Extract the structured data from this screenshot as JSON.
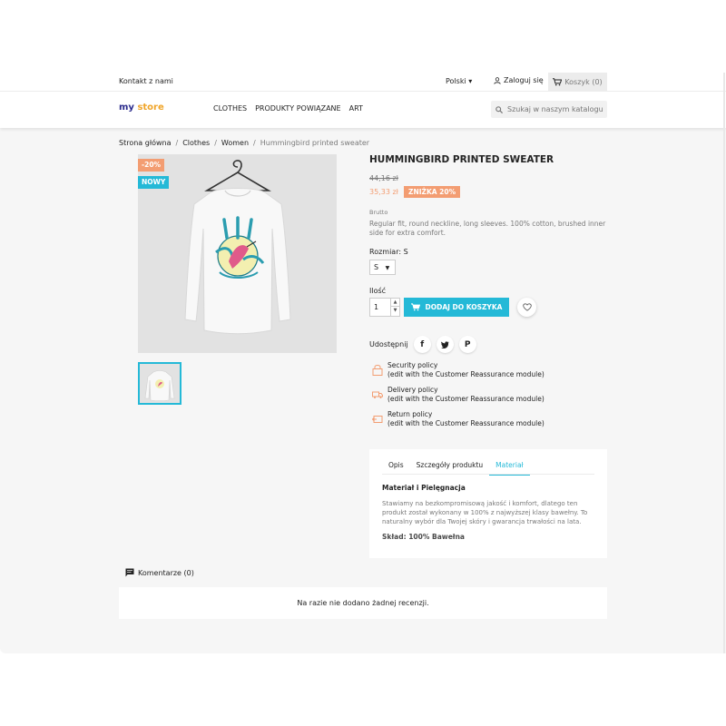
{
  "topbar": {
    "contact": "Kontakt z nami",
    "language": "Polski",
    "login": "Zaloguj się",
    "cart": "Koszyk (0)"
  },
  "header": {
    "logo_part1": "my",
    "logo_part2": "store",
    "nav": [
      "CLOTHES",
      "PRODUKTY POWIĄZANE",
      "ART"
    ],
    "search_placeholder": "Szukaj w naszym katalogu"
  },
  "breadcrumb": [
    "Strona główna",
    "Clothes",
    "Women",
    "Hummingbird printed sweater"
  ],
  "product": {
    "flag_discount": "-20%",
    "flag_new": "NOWY",
    "name": "HUMMINGBIRD PRINTED SWEATER",
    "old_price": "44,16 zł",
    "price": "35,33 zł",
    "discount_badge": "ZNIŻKA 20%",
    "tax_label": "Brutto",
    "description": "Regular fit, round neckline, long sleeves. 100% cotton, brushed inner side for extra comfort.",
    "size_label": "Rozmiar: S",
    "size_value": "S",
    "qty_label": "Ilość",
    "qty_value": "1",
    "add_to_cart": "DODAJ DO KOSZYKA",
    "share_label": "Udostępnij"
  },
  "reassurance": [
    {
      "title": "Security policy",
      "sub": "(edit with the Customer Reassurance module)"
    },
    {
      "title": "Delivery policy",
      "sub": "(edit with the Customer Reassurance module)"
    },
    {
      "title": "Return policy",
      "sub": "(edit with the Customer Reassurance module)"
    }
  ],
  "tabs": {
    "items": [
      "Opis",
      "Szczegóły produktu",
      "Materiał"
    ],
    "active_title": "Materiał i Pielęgnacja",
    "body": "Stawiamy na bezkompromisową jakość i komfort, dlatego ten produkt został wykonany w 100% z najwyższej klasy bawełny. To naturalny wybór dla Twojej skóry i gwarancja trwałości na lata.",
    "composition": "Skład: 100% Bawełna"
  },
  "comments": {
    "header": "Komentarze (0)",
    "empty": "Na razie nie dodano żadnej recenzji."
  },
  "colors": {
    "accent": "#24b9d7",
    "discount": "#f39d72"
  }
}
